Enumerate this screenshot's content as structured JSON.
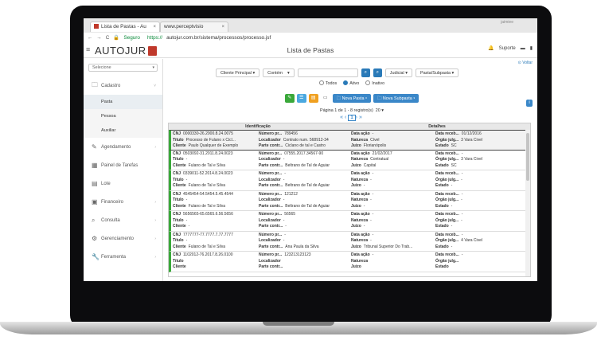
{
  "browser": {
    "tabs": [
      "Lista de Pastas - Au",
      "www.perceptvisio"
    ],
    "user": "jaimiee",
    "secure_label": "Seguro",
    "url_prefix": "https://",
    "url": "autojur.com.br/sistema/processos/processo.jsf"
  },
  "app": {
    "logo": "AUTOJUR",
    "page_title": "Lista de Pastas",
    "user_menu": "Suporte"
  },
  "sidebar": {
    "select_placeholder": "Selecione",
    "items": [
      {
        "label": "Cadastro",
        "icon": "folder-icon"
      },
      {
        "label": "Agendamento",
        "icon": "edit-icon"
      },
      {
        "label": "Painel de Tarefas",
        "icon": "calendar-icon"
      },
      {
        "label": "Lote",
        "icon": "stack-icon"
      },
      {
        "label": "Financeiro",
        "icon": "money-icon"
      },
      {
        "label": "Consulta",
        "icon": "search-icon"
      },
      {
        "label": "Gerenciamento",
        "icon": "cogs-icon"
      },
      {
        "label": "Ferramenta",
        "icon": "wrench-icon"
      }
    ],
    "sub_items": [
      "Pasta",
      "Pessoa",
      "Auxiliar"
    ]
  },
  "filters": {
    "voltar": "Voltar",
    "cliente": "Cliente Principal",
    "contem": "Contém",
    "judicial": "Judicial",
    "pasta": "Pasta/Subpasta",
    "radios": [
      "Todos",
      "Ativo",
      "Inativo"
    ],
    "nova_pasta": "Nova Pasta",
    "nova_subpasta": "Nova Subpasta"
  },
  "pager": {
    "text": "Página 1 de 1 - 8 registro(s)",
    "per_page": "20",
    "current": "1"
  },
  "grid": {
    "headers": [
      "Identificação",
      "Detalhes"
    ],
    "rows": [
      {
        "cnj": "0000330-26.2000.8.24.0075",
        "titulo": "Processo de Fulano x Cicl...",
        "cliente": "Paulo Qualquer de Exemplo",
        "numero": "789456",
        "localizador": "Contrato num. 568912-34",
        "parte": "Ciclano de tal e Castro",
        "acao": "-",
        "natureza": "Cível",
        "juizo": "Florianópolis",
        "receb": "01/12/2016",
        "orgao": "3 Vara Civel",
        "estado": "SC"
      },
      {
        "cnj": "0503092-31.2011.8.24.0023",
        "titulo": "-",
        "cliente": "Fulano de Tal e Silva",
        "numero": "07555.2017.34567-90",
        "localizador": "-",
        "parte": "Beltrano de Tal de Aguiar",
        "acao": "21/02/2017",
        "natureza": "Contratual",
        "juizo": "Capital",
        "receb": "-",
        "orgao": "3 Vara Civel",
        "estado": "SC"
      },
      {
        "cnj": "0339011-52.2014.8.24.0023",
        "titulo": "-",
        "cliente": "Fulano de Tal e Silva",
        "numero": "-",
        "localizador": "-",
        "parte": "Beltrano de Tal de Aguiar",
        "acao": "-",
        "natureza": "-",
        "juizo": "-",
        "receb": "-",
        "orgao": "-",
        "estado": "-"
      },
      {
        "cnj": "4545454-54.5454.5.45.4544",
        "titulo": "-",
        "cliente": "Fulano de Tal e Silva",
        "numero": "121212",
        "localizador": "-",
        "parte": "Beltrano de Tal de Aguiar",
        "acao": "-",
        "natureza": "-",
        "juizo": "-",
        "receb": "-",
        "orgao": "-",
        "estado": "-"
      },
      {
        "cnj": "5656565-65.6565.6.56.5656",
        "titulo": "-",
        "cliente": "-",
        "numero": "56565",
        "localizador": "-",
        "parte": "-",
        "acao": "-",
        "natureza": "-",
        "juizo": "-",
        "receb": "-",
        "orgao": "-",
        "estado": "-"
      },
      {
        "cnj": "7777777-77.7777.7.77.7777",
        "titulo": "-",
        "cliente": "Fulano de Tal e Silva",
        "numero": "-",
        "localizador": "-",
        "parte": "Ana Paula da Silva",
        "acao": "-",
        "natureza": "-",
        "juizo": "Tribunal Superior Do Trab...",
        "receb": "-",
        "orgao": "4 Vara Civel",
        "estado": "-"
      },
      {
        "cnj": "1102012-76.2017.8.26.0100",
        "titulo": "",
        "cliente": "",
        "numero": "123213123123",
        "localizador": "",
        "parte": "",
        "acao": "-",
        "natureza": "",
        "juizo": "",
        "receb": "-",
        "orgao": "",
        "estado": ""
      }
    ],
    "labels": {
      "cnj": "CNJ",
      "titulo": "Título",
      "cliente": "Cliente",
      "numero": "Número pr...",
      "localizador": "Localizador",
      "parte": "Parte contr...",
      "acao": "Data ação",
      "natureza": "Natureza",
      "juizo": "Juízo",
      "receb": "Data receb...",
      "orgao": "Órgão julg...",
      "estado": "Estado"
    }
  },
  "colors": {
    "accent": "#3a87c8",
    "brand": "#c0392b",
    "status_active": "#3aa83a"
  }
}
